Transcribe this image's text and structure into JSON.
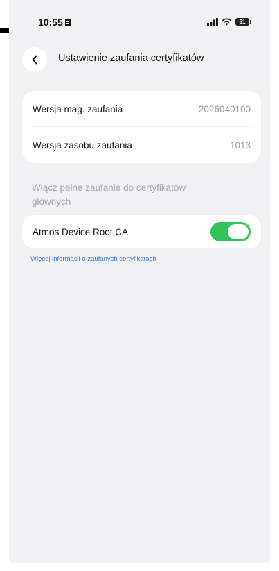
{
  "status_bar": {
    "time": "10:55",
    "battery_label": "61"
  },
  "header": {
    "title": "Ustawienie zaufania certyfikatów"
  },
  "versions": [
    {
      "label": "Wersja mag. zaufania",
      "value": "2026040100"
    },
    {
      "label": "Wersja zasobu zaufania",
      "value": "1013"
    }
  ],
  "trust_section": {
    "header": "Włącz pełne zaufanie do certyfikatów głównych",
    "certificates": [
      {
        "label": "Atmos Device Root CA",
        "enabled": true
      }
    ],
    "more_link": "Więcej informacji o zaufanych certyfikatach"
  },
  "colors": {
    "toggle_on": "#34c25c",
    "link": "#3a74d6",
    "background": "#f1f1f3"
  },
  "icons": {
    "back": "chevron-left-icon",
    "signal": "cellular-signal-icon",
    "wifi": "wifi-icon",
    "battery": "battery-icon",
    "sim": "sim-card-icon"
  }
}
